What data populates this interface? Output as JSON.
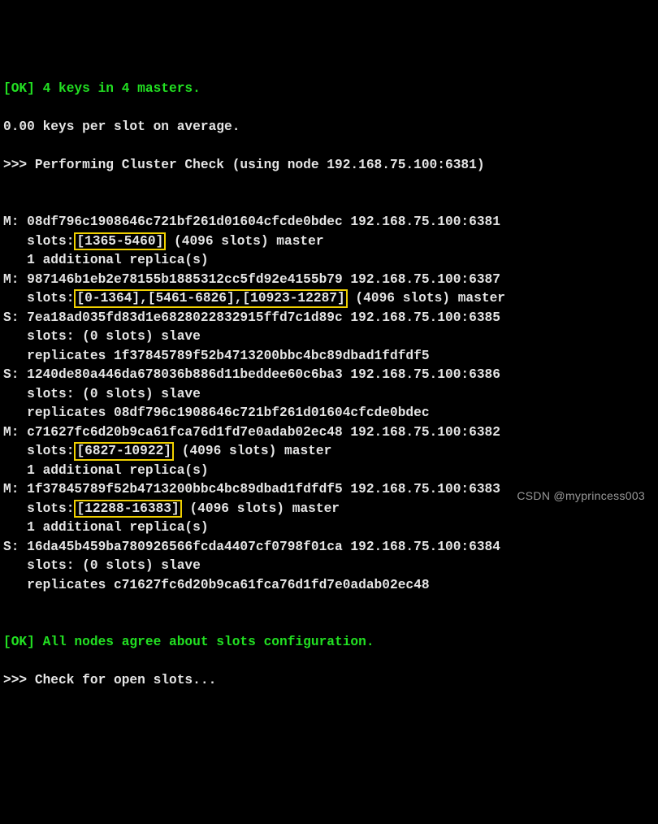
{
  "header": {
    "ok_line": "[OK] 4 keys in 4 masters.",
    "avg_line": "0.00 keys per slot on average.",
    "performing": ">>> Performing Cluster Check (using node 192.168.75.100:6381)"
  },
  "nodes": [
    {
      "role": "M",
      "id": "08df796c1908646c721bf261d01604cfcde0bdec",
      "addr": "192.168.75.100:6381",
      "slots_prefix": "   slots:",
      "slots_hl": "[1365-5460]",
      "slots_suffix": " (4096 slots) master",
      "extra": "   1 additional replica(s)"
    },
    {
      "role": "M",
      "id": "987146b1eb2e78155b1885312cc5fd92e4155b79",
      "addr": "192.168.75.100:6387",
      "slots_prefix": "   slots:",
      "slots_hl": "[0-1364],[5461-6826],[10923-12287]",
      "slots_suffix": " (4096 slots) master"
    },
    {
      "role": "S",
      "id": "7ea18ad035fd83d1e6828022832915ffd7c1d89c",
      "addr": "192.168.75.100:6385",
      "slots_line": "   slots: (0 slots) slave",
      "replicates": "   replicates 1f37845789f52b4713200bbc4bc89dbad1fdfdf5"
    },
    {
      "role": "S",
      "id": "1240de80a446da678036b886d11beddee60c6ba3",
      "addr": "192.168.75.100:6386",
      "slots_line": "   slots: (0 slots) slave",
      "replicates": "   replicates 08df796c1908646c721bf261d01604cfcde0bdec"
    },
    {
      "role": "M",
      "id": "c71627fc6d20b9ca61fca76d1fd7e0adab02ec48",
      "addr": "192.168.75.100:6382",
      "slots_prefix": "   slots:",
      "slots_hl": "[6827-10922]",
      "slots_suffix": " (4096 slots) master",
      "extra": "   1 additional replica(s)"
    },
    {
      "role": "M",
      "id": "1f37845789f52b4713200bbc4bc89dbad1fdfdf5",
      "addr": "192.168.75.100:6383",
      "slots_prefix": "   slots:",
      "slots_hl": "[12288-16383]",
      "slots_suffix": " (4096 slots) master",
      "extra": "   1 additional replica(s)"
    },
    {
      "role": "S",
      "id": "16da45b459ba780926566fcda4407cf0798f01ca",
      "addr": "192.168.75.100:6384",
      "slots_line": "   slots: (0 slots) slave",
      "replicates": "   replicates c71627fc6d20b9ca61fca76d1fd7e0adab02ec48"
    }
  ],
  "footer": {
    "agree": "[OK] All nodes agree about slots configuration.",
    "check_open": ">>> Check for open slots..."
  },
  "watermark": "CSDN @myprincess003"
}
